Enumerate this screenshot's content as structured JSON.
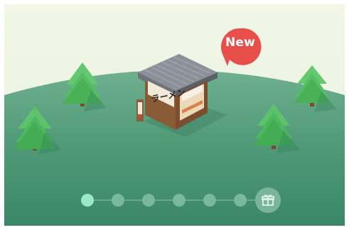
{
  "badge": {
    "label": "New",
    "color": "#e84f4b"
  },
  "shop": {
    "sign": "ラーメン"
  },
  "pager": {
    "total_steps": 6,
    "current_step": 1,
    "reward_icon": "gift-icon"
  },
  "colors": {
    "sky": "#eef4e3",
    "hill": "#4d9a79",
    "active_dot": "#9be8c6",
    "inactive_dot": "#79b898"
  }
}
